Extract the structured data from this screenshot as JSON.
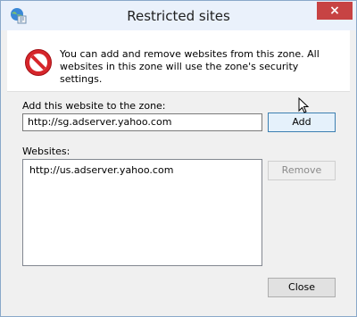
{
  "window": {
    "title": "Restricted sites",
    "close_symbol": "×"
  },
  "info": {
    "message": "You can add and remove websites from this zone. All websites in this zone will use the zone's security settings."
  },
  "form": {
    "add_label": "Add this website to the zone:",
    "add_input_value": "http://sg.adserver.yahoo.com",
    "add_button": "Add",
    "websites_label": "Websites:",
    "websites": [
      "http://us.adserver.yahoo.com"
    ],
    "remove_button": "Remove",
    "close_button": "Close"
  },
  "icons": {
    "title": "internet-options-globe-icon",
    "info": "restricted-no-entry-icon",
    "cursor": "mouse-pointer-icon"
  },
  "colors": {
    "accent": "#3c7fb1",
    "danger": "#d6262b",
    "disabled_text": "#8a8a8a"
  }
}
